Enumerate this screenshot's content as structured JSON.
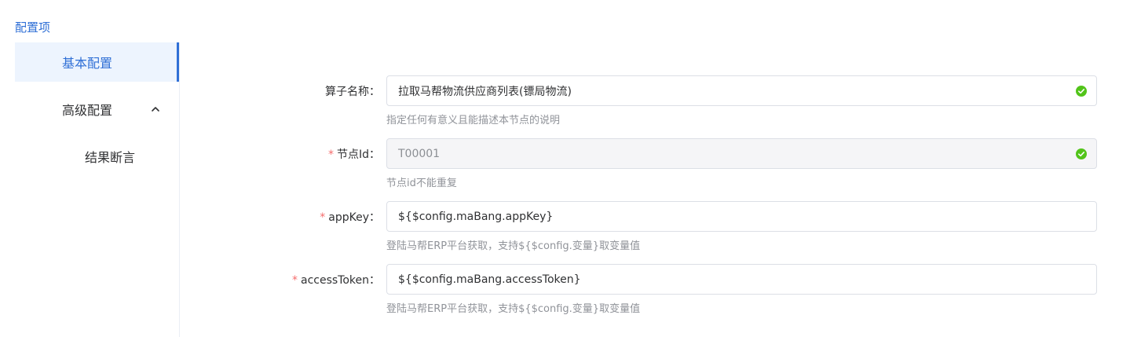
{
  "section_title": "配置项",
  "sidebar": {
    "items": [
      {
        "label": "基本配置",
        "active": true
      },
      {
        "label": "高级配置",
        "expanded": true,
        "chevron_icon": "chevron-up-icon"
      },
      {
        "label": "结果断言"
      }
    ]
  },
  "form": {
    "fields": [
      {
        "label": "算子名称",
        "required": false,
        "value": "拉取马帮物流供应商列表(镖局物流)",
        "valid": true,
        "disabled": false,
        "help": "指定任何有意义且能描述本节点的说明"
      },
      {
        "label": "节点Id",
        "required": true,
        "value": "T00001",
        "valid": true,
        "disabled": true,
        "help": "节点id不能重复"
      },
      {
        "label": "appKey",
        "required": true,
        "value": "${$config.maBang.appKey}",
        "valid": false,
        "disabled": false,
        "help": "登陆马帮ERP平台获取，支持${$config.变量}取变量值"
      },
      {
        "label": "accessToken",
        "required": true,
        "value": "${$config.maBang.accessToken}",
        "valid": false,
        "disabled": false,
        "help": "登陆马帮ERP平台获取，支持${$config.变量}取变量值"
      }
    ],
    "label_suffix": "：",
    "required_mark": "*"
  },
  "colors": {
    "accent": "#2f6fd6",
    "success": "#52c41a",
    "required": "#f56c6c"
  }
}
